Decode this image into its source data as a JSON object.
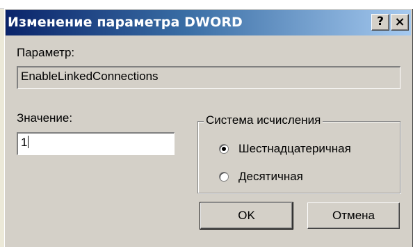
{
  "window": {
    "title": "Изменение параметра DWORD",
    "help_button": "?",
    "close_button": "×"
  },
  "parameter": {
    "label": "Параметр:",
    "value": "EnableLinkedConnections"
  },
  "value_field": {
    "label": "Значение:",
    "value": "1"
  },
  "number_system": {
    "legend": "Система исчисления",
    "options": [
      {
        "label": "Шестнадцатеричная",
        "selected": true
      },
      {
        "label": "Десятичная",
        "selected": false
      }
    ]
  },
  "buttons": {
    "ok": "OK",
    "cancel": "Отмена"
  }
}
